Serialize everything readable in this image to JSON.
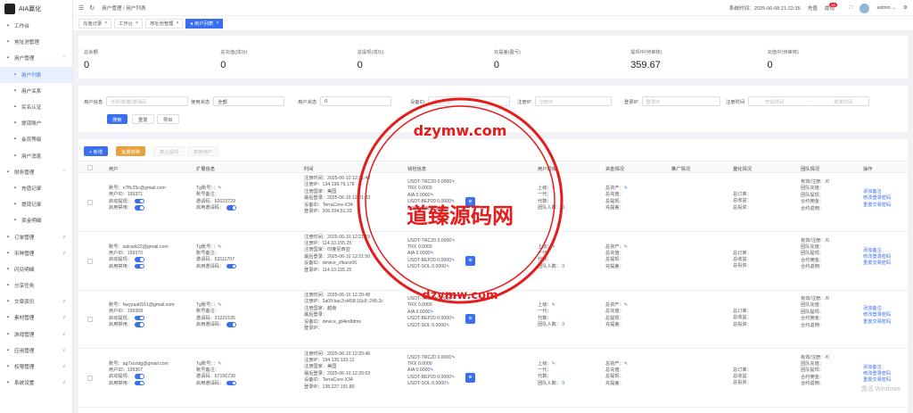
{
  "logo": "AIA赢化",
  "menu": [
    {
      "icon": "monitor-icon",
      "label": "工作台",
      "chev": ""
    },
    {
      "icon": "list-icon",
      "label": "地址池管理",
      "chev": ""
    },
    {
      "icon": "user-icon",
      "label": "用户管理",
      "chev": "^"
    },
    {
      "icon": "users-icon",
      "label": "用户列表",
      "chev": "",
      "sub": true,
      "active": true
    },
    {
      "icon": "person-icon",
      "label": "用户关系",
      "chev": "",
      "sub": true
    },
    {
      "icon": "id-card-icon",
      "label": "实名认证",
      "chev": "",
      "sub": true
    },
    {
      "icon": "doc-icon",
      "label": "提现账户",
      "chev": "",
      "sub": true
    },
    {
      "icon": "rocket-icon",
      "label": "会员等级",
      "chev": "",
      "sub": true
    },
    {
      "icon": "message-icon",
      "label": "用户消息",
      "chev": "",
      "sub": true
    },
    {
      "icon": "wallet-icon",
      "label": "财务管理",
      "chev": "^"
    },
    {
      "icon": "doc-icon",
      "label": "充值记录",
      "chev": "",
      "sub": true
    },
    {
      "icon": "doc-icon",
      "label": "提现记录",
      "chev": "",
      "sub": true
    },
    {
      "icon": "chart-icon",
      "label": "资金明细",
      "chev": "",
      "sub": true
    },
    {
      "icon": "order-icon",
      "label": "订单管理",
      "chev": "v"
    },
    {
      "icon": "coin-icon",
      "label": "币种管理",
      "chev": "v"
    },
    {
      "icon": "flash-icon",
      "label": "闪兑明细",
      "chev": ""
    },
    {
      "icon": "share-icon",
      "label": "分享任务",
      "chev": ""
    },
    {
      "icon": "article-icon",
      "label": "文章资讯",
      "chev": "v"
    },
    {
      "icon": "image-icon",
      "label": "素材管理",
      "chev": "v"
    },
    {
      "icon": "game-icon",
      "label": "游戏管理",
      "chev": "v"
    },
    {
      "icon": "app-icon",
      "label": "应用管理",
      "chev": "v"
    },
    {
      "icon": "lock-icon",
      "label": "权限管理",
      "chev": "v"
    },
    {
      "icon": "gear-icon",
      "label": "系统设置",
      "chev": "v"
    }
  ],
  "header": {
    "breadcrumb": "用户管理 / 用户列表",
    "time": "系统时间：2025-06-08 21:22:35",
    "recharge": "充值",
    "withdraw": "提现",
    "badge": "38",
    "user": "admin"
  },
  "tabs": [
    {
      "label": "充值记录",
      "active": false
    },
    {
      "label": "工作台",
      "active": false
    },
    {
      "label": "地址池管理",
      "active": false
    },
    {
      "label": "● 用户列表",
      "active": true
    }
  ],
  "stats": [
    {
      "label": "总余额",
      "value": "0"
    },
    {
      "label": "总充值(成功)",
      "value": "0"
    },
    {
      "label": "总提现(成功)",
      "value": "0"
    },
    {
      "label": "充提差(盈亏)",
      "value": "0"
    },
    {
      "label": "提现中(待审核)",
      "value": "359.67"
    },
    {
      "label": "充值中(待审核)",
      "value": "0"
    }
  ],
  "filters": {
    "user_info": "用户信息",
    "user_info_ph": "手机/邮箱/邀请码",
    "type_label": "使用状态",
    "type_val": "全部",
    "status_label": "用户状态",
    "status_val": "0",
    "device_label": "设备ID",
    "device_ph": "请输入ID",
    "reg_ip_label": "注册IP",
    "reg_ip_ph": "注册IP",
    "login_ip_label": "登录IP",
    "login_ip_ph": "登录IP",
    "reg_time_label": "注册时间",
    "start_ph": "开始时间",
    "sep": "-",
    "end_ph": "结束时间",
    "search": "搜索",
    "reset": "重置",
    "export": "导出"
  },
  "actions": {
    "add": "+ 新增",
    "batch": "批量转移",
    "disable": "禁止提现",
    "disable_user": "禁用用户"
  },
  "columns": [
    "用户",
    "扩展信息",
    "时间",
    "钱包信息",
    "用户层级",
    "资金情况",
    "推广情况",
    "量化情况",
    "团队情况",
    "操作"
  ],
  "common": {
    "account": "账号：",
    "uid": "用户ID：",
    "launch_login": "启动提现：",
    "enable_disable": "启用禁用：",
    "tg": "Tg账号：：",
    "note": "账号备注：",
    "invite": "邀请码：",
    "invite_switch": "启用邀请码：",
    "reg_time": "注册时间：",
    "reg_ip": "注册IP：",
    "reg_country": "注册国家：",
    "last_login": "最后登录：",
    "device": "设备ID：",
    "login_ip": "登录IP：",
    "w1": "USDT-TRC20",
    "w2": "TRX",
    "w3": "AIA",
    "w4": "USDT-BEP20",
    "w5": "USDT-SOL",
    "up": "上级：",
    "l1": "一代：",
    "l2": "代数：",
    "team": "团队人数：",
    "team_zero": "0",
    "f1": "总资产：",
    "f2": "总充值：",
    "f3": "总提现：",
    "f4": "充提差：",
    "q1": "总订单：",
    "q2": "总收益：",
    "q3": "总投资：",
    "t1": "有效/注册：/0",
    "t2": "团队充值：",
    "t3": "团队提现：",
    "t4": "合约佣金：",
    "t5": "合约返佣：",
    "op1": "添加备注",
    "op2": "修改登录密码",
    "op3": "重置交易密码"
  },
  "rows": [
    {
      "email": "x7ffc25c@gmail.com",
      "uid": "199371",
      "invite": "62023729",
      "reg_time": "2025-06-10 12:21:40",
      "reg_ip": "134.199.79.178",
      "country": "美国",
      "last": "2025-06-10 12:21:33",
      "device": "TerraCore-X34",
      "login_ip": "206.204.51.33",
      "w": [
        "0.0000",
        "0.0000",
        "0.0000",
        "0.0000",
        "0.0000"
      ]
    },
    {
      "email": "salcark22@gmail.com",
      "uid": "199370",
      "invite": "63111707",
      "reg_time": "2025-06-10 12:21:19",
      "reg_ip": "114.10.155.25",
      "country": "印度尼西亚",
      "last": "2025-06-10 12:21:50",
      "device": "device_cfkaxs06",
      "login_ip": "114.10.155.25",
      "w": [
        "0.0000",
        "0.0000",
        "0.0000",
        "0.0000",
        "0.0000"
      ]
    },
    {
      "email": "hwyyaaft161@gmail.com",
      "uid": "199368",
      "invite": "21221535",
      "reg_time": "2025-06-10 12:20:48",
      "reg_ip": "2a09:bac3:d458:16c8::245:2c",
      "country": "越南",
      "last": "",
      "device": "device_gt4kn8dmx",
      "login_ip": "",
      "w": [
        "0.0000",
        "0.0000",
        "0.0000",
        "0.0000",
        "0.0000"
      ]
    },
    {
      "email": "ag7xcodg@gmail.com",
      "uid": "199367",
      "invite": "67156730",
      "reg_time": "2025-06-10 12:20:46",
      "reg_ip": "194.135.133.12",
      "country": "美国",
      "last": "2025-06-10 12:20:53",
      "device": "TerraCore-X34",
      "login_ip": "138.227.191.80",
      "w": [
        "0.0000",
        "0.0000",
        "0.0000",
        "0.0000",
        "0.0000"
      ]
    }
  ],
  "watermark": {
    "text": "道臻源码网",
    "ring": "dzymw.com",
    "windows": "激活 Windows"
  }
}
